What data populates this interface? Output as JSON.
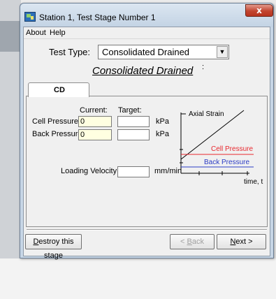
{
  "window": {
    "title": "Station 1, Test Stage Number 1",
    "close_glyph": "x"
  },
  "menu": [
    {
      "label": "About"
    },
    {
      "label": "Help"
    }
  ],
  "test_type": {
    "label": "Test Type:",
    "selected": "Consolidated Drained",
    "dropdown_glyph": "▼"
  },
  "heading": {
    "text": "Consolidated Drained",
    "mark": ":"
  },
  "tab": {
    "label": "CD"
  },
  "form": {
    "col_current": "Current:",
    "col_target": "Target:",
    "cell_pressure_label": "Cell Pressure:",
    "cell_pressure_current": "0",
    "cell_pressure_target": "",
    "back_pressure_label": "Back Pressure:",
    "back_pressure_current": "0",
    "back_pressure_target": "",
    "pressure_unit": "kPa",
    "loading_velocity_label": "Loading Velocity:",
    "loading_velocity_value": "",
    "velocity_unit": "mm/min"
  },
  "diagram": {
    "axial_strain": "Axial Strain",
    "cell_pressure": "Cell Pressure",
    "back_pressure": "Back Pressure",
    "time_label": "time, t",
    "colors": {
      "cell_pressure": "#e8282e",
      "back_pressure": "#2b3bc4",
      "axial_strain": "#000000"
    }
  },
  "buttons": {
    "destroy_prefix": "D",
    "destroy_rest": "estroy this stage",
    "back_arrow": "< ",
    "back_key": "B",
    "back_rest": "ack",
    "next_key": "N",
    "next_rest": "ext >"
  }
}
